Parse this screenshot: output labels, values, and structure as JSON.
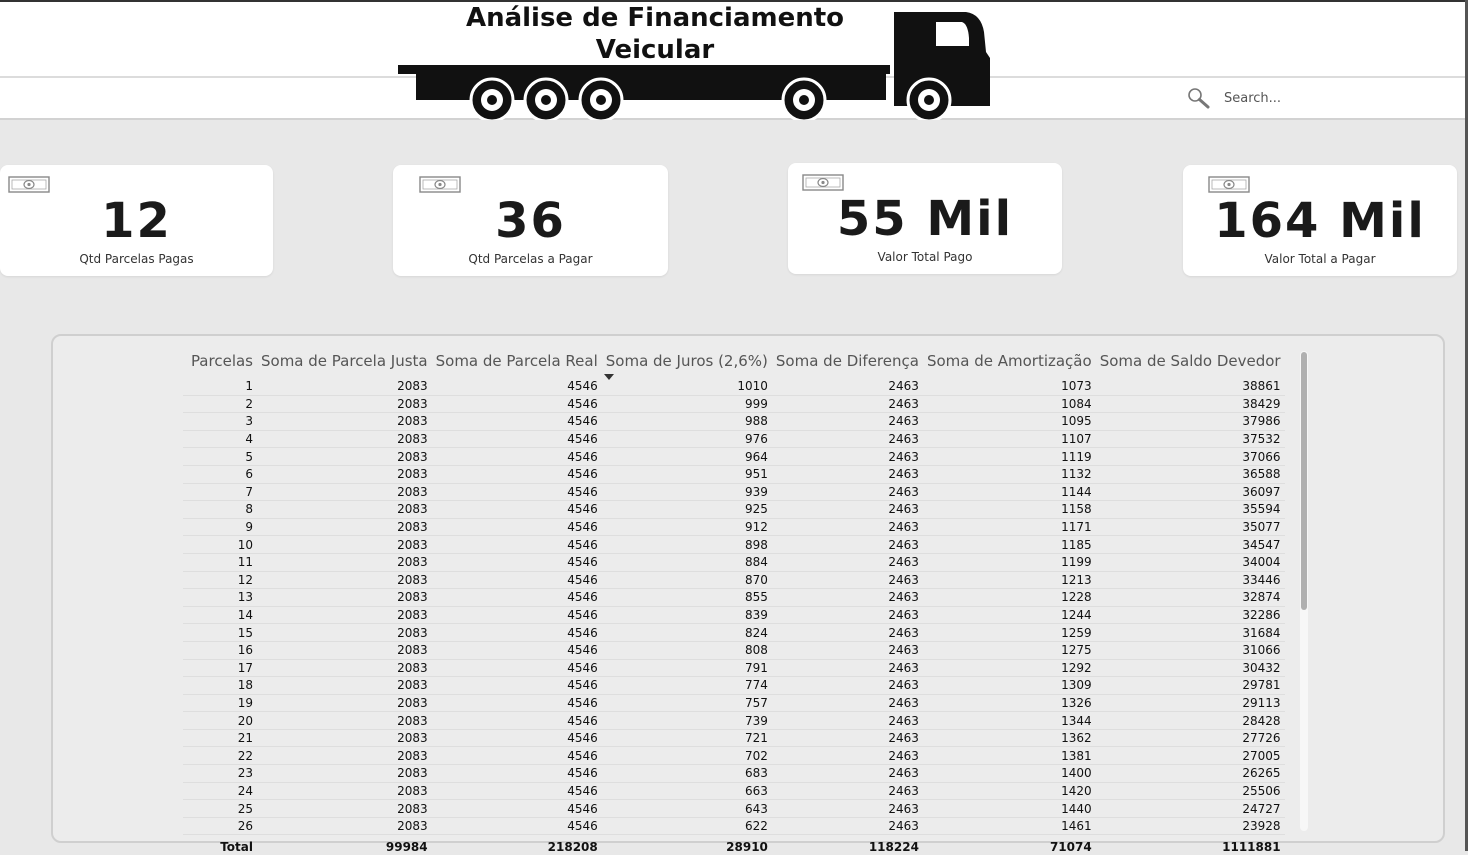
{
  "header": {
    "title_line1": "Análise de Financiamento",
    "title_line2": "Veicular",
    "search_placeholder": "Search..."
  },
  "kpis": [
    {
      "value": "12",
      "label": "Qtd Parcelas Pagas",
      "icon": "money-bill-icon"
    },
    {
      "value": "36",
      "label": "Qtd Parcelas a Pagar",
      "icon": "money-bill-icon"
    },
    {
      "value": "55 Mil",
      "label": "Valor Total Pago",
      "icon": "money-bill-icon"
    },
    {
      "value": "164 Mil",
      "label": "Valor Total a Pagar",
      "icon": "money-bill-icon"
    }
  ],
  "table": {
    "columns": [
      "Parcelas",
      "Soma de Parcela Justa",
      "Soma de Parcela Real",
      "Soma de Juros (2,6%)",
      "Soma de Diferença",
      "Soma de Amortização",
      "Soma de Saldo Devedor"
    ],
    "sorted_column": "Soma de Juros (2,6%)",
    "rows": [
      [
        "1",
        "2083",
        "4546",
        "1010",
        "2463",
        "1073",
        "38861"
      ],
      [
        "2",
        "2083",
        "4546",
        "999",
        "2463",
        "1084",
        "38429"
      ],
      [
        "3",
        "2083",
        "4546",
        "988",
        "2463",
        "1095",
        "37986"
      ],
      [
        "4",
        "2083",
        "4546",
        "976",
        "2463",
        "1107",
        "37532"
      ],
      [
        "5",
        "2083",
        "4546",
        "964",
        "2463",
        "1119",
        "37066"
      ],
      [
        "6",
        "2083",
        "4546",
        "951",
        "2463",
        "1132",
        "36588"
      ],
      [
        "7",
        "2083",
        "4546",
        "939",
        "2463",
        "1144",
        "36097"
      ],
      [
        "8",
        "2083",
        "4546",
        "925",
        "2463",
        "1158",
        "35594"
      ],
      [
        "9",
        "2083",
        "4546",
        "912",
        "2463",
        "1171",
        "35077"
      ],
      [
        "10",
        "2083",
        "4546",
        "898",
        "2463",
        "1185",
        "34547"
      ],
      [
        "11",
        "2083",
        "4546",
        "884",
        "2463",
        "1199",
        "34004"
      ],
      [
        "12",
        "2083",
        "4546",
        "870",
        "2463",
        "1213",
        "33446"
      ],
      [
        "13",
        "2083",
        "4546",
        "855",
        "2463",
        "1228",
        "32874"
      ],
      [
        "14",
        "2083",
        "4546",
        "839",
        "2463",
        "1244",
        "32286"
      ],
      [
        "15",
        "2083",
        "4546",
        "824",
        "2463",
        "1259",
        "31684"
      ],
      [
        "16",
        "2083",
        "4546",
        "808",
        "2463",
        "1275",
        "31066"
      ],
      [
        "17",
        "2083",
        "4546",
        "791",
        "2463",
        "1292",
        "30432"
      ],
      [
        "18",
        "2083",
        "4546",
        "774",
        "2463",
        "1309",
        "29781"
      ],
      [
        "19",
        "2083",
        "4546",
        "757",
        "2463",
        "1326",
        "29113"
      ],
      [
        "20",
        "2083",
        "4546",
        "739",
        "2463",
        "1344",
        "28428"
      ],
      [
        "21",
        "2083",
        "4546",
        "721",
        "2463",
        "1362",
        "27726"
      ],
      [
        "22",
        "2083",
        "4546",
        "702",
        "2463",
        "1381",
        "27005"
      ],
      [
        "23",
        "2083",
        "4546",
        "683",
        "2463",
        "1400",
        "26265"
      ],
      [
        "24",
        "2083",
        "4546",
        "663",
        "2463",
        "1420",
        "25506"
      ],
      [
        "25",
        "2083",
        "4546",
        "643",
        "2463",
        "1440",
        "24727"
      ],
      [
        "26",
        "2083",
        "4546",
        "622",
        "2463",
        "1461",
        "23928"
      ]
    ],
    "total": [
      "Total",
      "99984",
      "218208",
      "28910",
      "118224",
      "71074",
      "1111881"
    ]
  }
}
